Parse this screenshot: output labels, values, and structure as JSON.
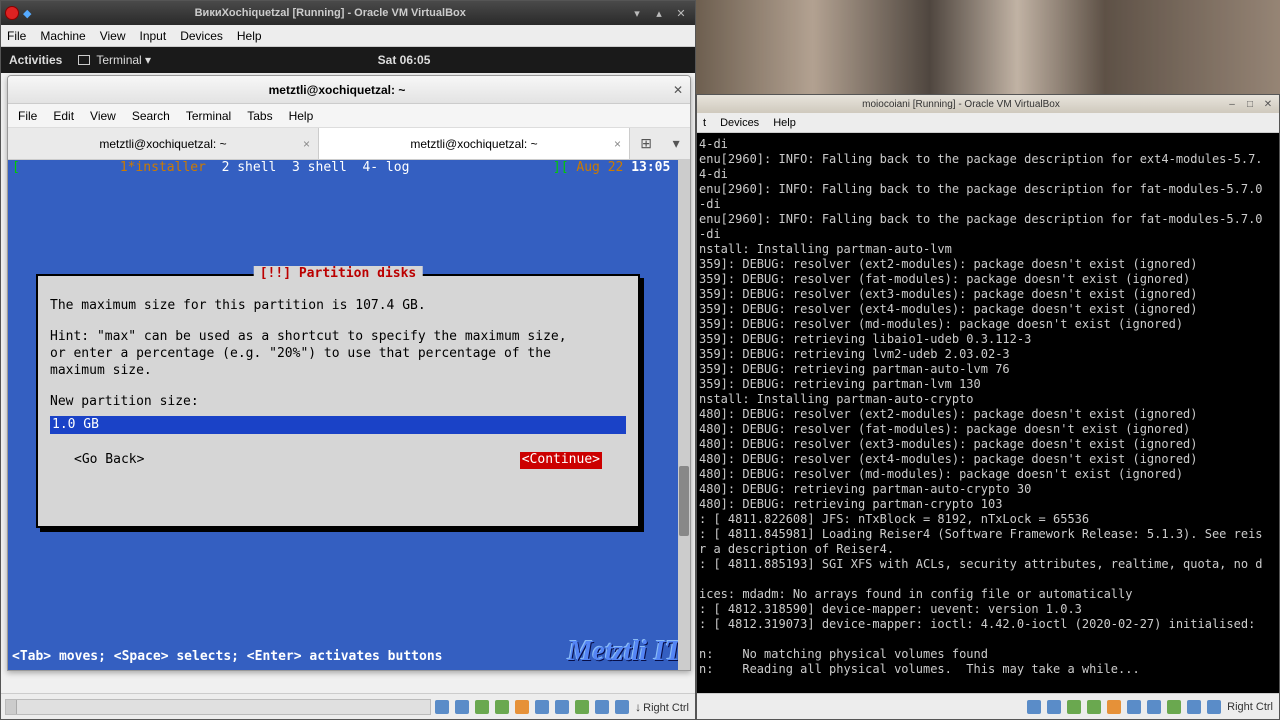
{
  "left_vm": {
    "title": "ВикиXochiquetzal [Running] - Oracle VM VirtualBox",
    "menu": [
      "File",
      "Machine",
      "View",
      "Input",
      "Devices",
      "Help"
    ],
    "host_key": "Right Ctrl"
  },
  "gnome": {
    "activities": "Activities",
    "app": "Terminal ▾",
    "clock": "Sat 06:05"
  },
  "terminal": {
    "title": "metztli@xochiquetzal: ~",
    "menu": [
      "File",
      "Edit",
      "View",
      "Search",
      "Terminal",
      "Tabs",
      "Help"
    ],
    "tabs": [
      {
        "label": "metztli@xochiquetzal: ~",
        "active": false
      },
      {
        "label": "metztli@xochiquetzal: ~",
        "active": true
      }
    ],
    "status_segments": {
      "open": "[",
      "active": "1*installer",
      "rest": "  2 shell  3 shell  4- log",
      "close_gap": "         ][",
      "date": " Aug 22 ",
      "time": "13:05",
      "close": " ]"
    },
    "hint": "<Tab> moves; <Space> selects; <Enter> activates buttons",
    "watermark": "Metztli IT"
  },
  "dialog": {
    "title": "[!!] Partition disks",
    "body_1": "The maximum size for this partition is 107.4 GB.",
    "body_2": "Hint: \"max\" can be used as a shortcut to specify the maximum size,\nor enter a percentage (e.g. \"20%\") to use that percentage of the\nmaximum size.",
    "prompt": "New partition size:",
    "input_value": "1.0 GB",
    "go_back": "<Go Back>",
    "continue": "<Continue>"
  },
  "right_vm": {
    "title": "moiocoiani [Running] - Oracle VM VirtualBox",
    "menu_partial": [
      "t",
      "Devices",
      "Help"
    ],
    "host_key": "Right Ctrl",
    "log_lines": [
      "4-di",
      "enu[2960]: INFO: Falling back to the package description for ext4-modules-5.7.",
      "4-di",
      "enu[2960]: INFO: Falling back to the package description for fat-modules-5.7.0",
      "-di",
      "enu[2960]: INFO: Falling back to the package description for fat-modules-5.7.0",
      "-di",
      "nstall: Installing partman-auto-lvm",
      "359]: DEBUG: resolver (ext2-modules): package doesn't exist (ignored)",
      "359]: DEBUG: resolver (fat-modules): package doesn't exist (ignored)",
      "359]: DEBUG: resolver (ext3-modules): package doesn't exist (ignored)",
      "359]: DEBUG: resolver (ext4-modules): package doesn't exist (ignored)",
      "359]: DEBUG: resolver (md-modules): package doesn't exist (ignored)",
      "359]: DEBUG: retrieving libaio1-udeb 0.3.112-3",
      "359]: DEBUG: retrieving lvm2-udeb 2.03.02-3",
      "359]: DEBUG: retrieving partman-auto-lvm 76",
      "359]: DEBUG: retrieving partman-lvm 130",
      "nstall: Installing partman-auto-crypto",
      "480]: DEBUG: resolver (ext2-modules): package doesn't exist (ignored)",
      "480]: DEBUG: resolver (fat-modules): package doesn't exist (ignored)",
      "480]: DEBUG: resolver (ext3-modules): package doesn't exist (ignored)",
      "480]: DEBUG: resolver (ext4-modules): package doesn't exist (ignored)",
      "480]: DEBUG: resolver (md-modules): package doesn't exist (ignored)",
      "480]: DEBUG: retrieving partman-auto-crypto 30",
      "480]: DEBUG: retrieving partman-crypto 103",
      ": [ 4811.822608] JFS: nTxBlock = 8192, nTxLock = 65536",
      ": [ 4811.845981] Loading Reiser4 (Software Framework Release: 5.1.3). See reis",
      "r a description of Reiser4.",
      ": [ 4811.885193] SGI XFS with ACLs, security attributes, realtime, quota, no d",
      "",
      "ices: mdadm: No arrays found in config file or automatically",
      ": [ 4812.318590] device-mapper: uevent: version 1.0.3",
      ": [ 4812.319073] device-mapper: ioctl: 4.42.0-ioctl (2020-02-27) initialised:",
      "",
      "n:    No matching physical volumes found",
      "n:    Reading all physical volumes.  This may take a while..."
    ]
  }
}
